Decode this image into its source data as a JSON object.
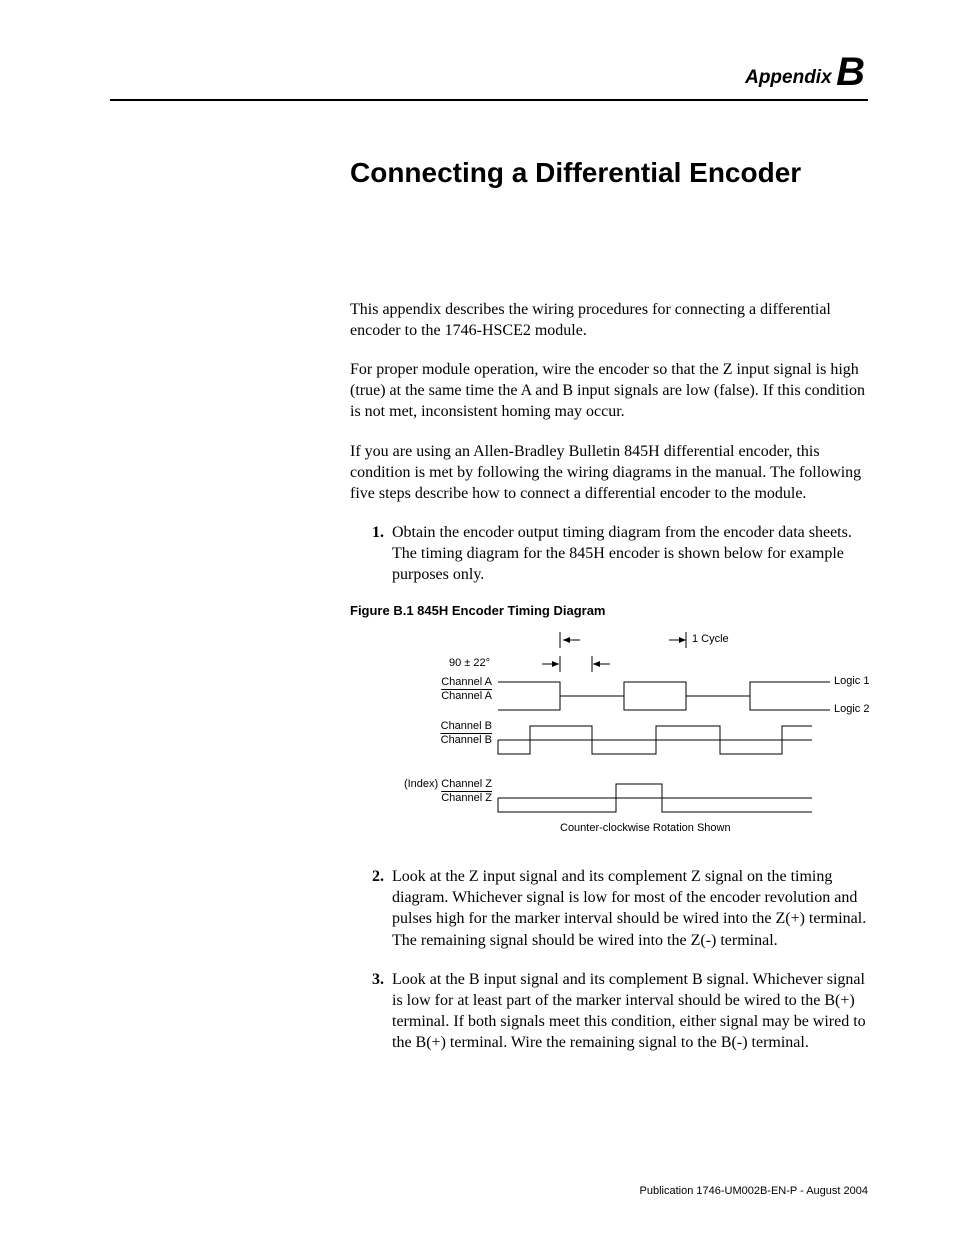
{
  "header": {
    "word": "Appendix",
    "letter": "B"
  },
  "title": "Connecting a Differential Encoder",
  "intro": [
    "This appendix describes the wiring procedures for connecting a differential encoder to the 1746-HSCE2 module.",
    "For proper module operation, wire the encoder so that the Z input signal is high (true) at the same time the A and B input signals are low (false). If this condition is not met, inconsistent homing may occur.",
    "If you are using an Allen-Bradley Bulletin 845H differential encoder, this condition is met by following the wiring diagrams in the manual. The following five steps describe how to connect a differential encoder to the module."
  ],
  "steps": {
    "n1": "1.",
    "s1": "Obtain the encoder output timing diagram from the encoder data sheets. The timing diagram for the 845H encoder is shown below for example purposes only.",
    "n2": "2.",
    "s2": "Look at the Z input signal and its complement Z signal on the timing diagram. Whichever signal is low for most of the encoder revolution and pulses high for the marker interval should be wired into the Z(+) terminal. The remaining signal should be wired into the Z(-) terminal.",
    "n3": "3.",
    "s3": "Look at the B input signal and its complement B signal. Whichever signal is low for at least part of the marker interval should be wired to the B(+) terminal. If both signals meet this condition, either signal may be wired to the B(+) terminal. Wire the remaining signal to the B(-) terminal."
  },
  "figure": {
    "caption": "Figure B.1 845H Encoder Timing Diagram",
    "labels": {
      "cycle": "1 Cycle",
      "phase": "90 ± 22°",
      "chA": "Channel A",
      "chAbar": "Channel A",
      "chB": "Channel B",
      "chBbar": "Channel B",
      "chZ": "(Index) Channel Z",
      "chZbar": "Channel Z",
      "logic1": "Logic 1",
      "logic2": "Logic 2",
      "rotation": "Counter-clockwise Rotation Shown"
    }
  },
  "footer": "Publication 1746-UM002B-EN-P - August 2004"
}
